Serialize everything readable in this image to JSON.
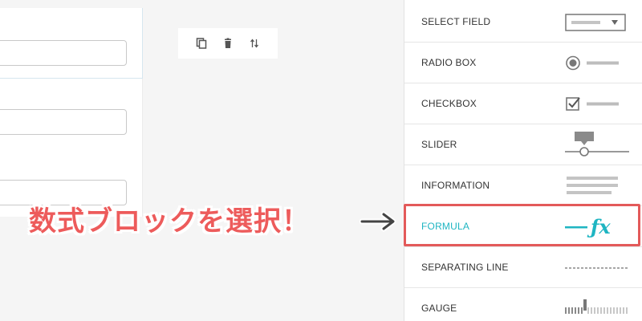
{
  "callout": {
    "text": "数式ブロックを選択！",
    "arrow": "→"
  },
  "toolbar": {
    "icons": [
      "copy-icon",
      "trash-icon",
      "reorder-icon"
    ]
  },
  "panel": {
    "items": [
      {
        "label": "SELECT FIELD",
        "icon": "select-field-icon"
      },
      {
        "label": "RADIO BOX",
        "icon": "radio-icon"
      },
      {
        "label": "CHECKBOX",
        "icon": "checkbox-icon"
      },
      {
        "label": "SLIDER",
        "icon": "slider-icon"
      },
      {
        "label": "INFORMATION",
        "icon": "information-icon"
      },
      {
        "label": "FORMULA",
        "icon": "formula-icon",
        "highlighted": true,
        "glyph": "fx"
      },
      {
        "label": "SEPARATING LINE",
        "icon": "separating-line-icon"
      },
      {
        "label": "GAUGE",
        "icon": "gauge-icon"
      }
    ]
  },
  "colors": {
    "accent": "#1fb5c2",
    "highlight": "#e35a5a",
    "callout_text": "#ed5b5b",
    "icon_gray": "#888888"
  }
}
